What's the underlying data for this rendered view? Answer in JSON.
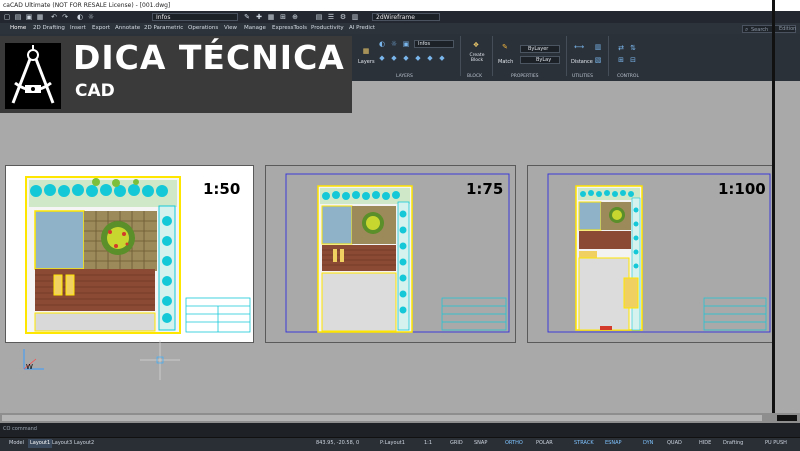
{
  "window": {
    "title": "caCAD Ultimate (NOT FOR RESALE License) - [001.dwg]"
  },
  "quick_access": {
    "layer_value": "Infos",
    "visual_style": "2dWireframe"
  },
  "ribbon_tabs": [
    "Home",
    "2D Drafting",
    "Insert",
    "Export",
    "Annotate",
    "2D Parametric",
    "Operations",
    "View",
    "Manage",
    "ExpressTools",
    "Productivity",
    "AI Predict"
  ],
  "search": {
    "placeholder": "Search",
    "edition": "Edition"
  },
  "ribbon": {
    "layers_label": "Layers",
    "layers_panel": "LAYERS",
    "layer_value": "Infos",
    "create_block": "Create Block",
    "block_panel": "BLOCK",
    "match": "Match",
    "bylayer_1": "ByLayer",
    "bylayer_2": "ByLay",
    "properties_panel": "PROPERTIES",
    "distance": "Distance",
    "utilities_panel": "UTILITIES",
    "control_panel": "CONTROL"
  },
  "overlay": {
    "title": "DICA TÉCNICA",
    "subtitle": "CAD"
  },
  "viewports": [
    {
      "scale": "1:50"
    },
    {
      "scale": "1:75"
    },
    {
      "scale": "1:100"
    }
  ],
  "ucs": {
    "w_label": "W"
  },
  "command_line": {
    "text": "CO  command"
  },
  "layout_tabs": [
    "Model",
    "Layout1",
    "Layout3",
    "Layout2"
  ],
  "active_layout": "Layout1",
  "status": {
    "coords": "843.95, -20.58, 0",
    "paper": "P:Layout1",
    "scale": "1:1",
    "grid": "GRID",
    "snap": "SNAP",
    "ortho": "ORTHO",
    "polar": "POLAR",
    "strack": "STRACK",
    "esnap": "ESNAP",
    "dyn": "DYN",
    "quad": "QUAD",
    "hide": "HIDE",
    "workspace": "Drafting",
    "pupush": "PU PUSH"
  },
  "colors": {
    "canvas_bg": "#a9a9a9",
    "ribbon_bg": "#2b3139",
    "overlay_bg": "#3a3a3a",
    "plan_yellow": "#ffe600",
    "plan_cyan": "#14c8d8",
    "pool_blue": "#8fb2c9",
    "deck_brown": "#8a4a33",
    "viewport_blue": "#3b3bd6"
  }
}
